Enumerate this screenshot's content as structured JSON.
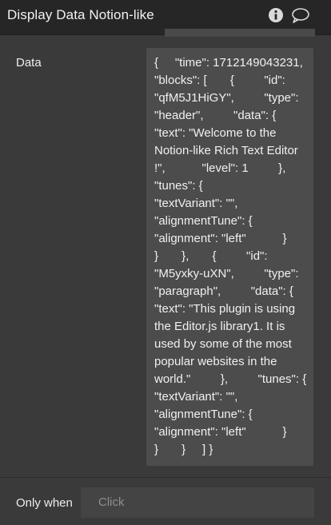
{
  "window": {
    "title": "Display Data Notion-like"
  },
  "icons": {
    "info": "info-icon",
    "comment": "comment-bubble-icon"
  },
  "fields": {
    "data_label": "Data",
    "data_value": "{     \"time\": 1712149043231,     \"blocks\": [       {         \"id\": \"qfM5J1HiGY\",         \"type\": \"header\",         \"data\": {           \"text\": \"Welcome to the Notion-like Rich Text Editor !\",           \"level\": 1         },         \"tunes\": {           \"textVariant\": \"\",           \"alignmentTune\": {             \"alignment\": \"left\"           }         }       },       {         \"id\": \"M5yxky-uXN\",         \"type\": \"paragraph\",         \"data\": {           \"text\": \"This plugin is using the Editor.js library1. It is used by some of the most popular websites in the world.\"         },         \"tunes\": {           \"textVariant\": \"\",           \"alignmentTune\": {             \"alignment\": \"left\"           }         }       }     ] }",
    "only_when_label": "Only when",
    "only_when_placeholder": "Click"
  }
}
